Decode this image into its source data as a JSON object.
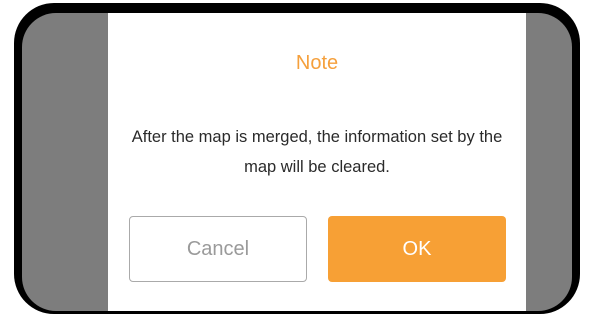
{
  "dialog": {
    "title": "Note",
    "message": "After the map is merged, the information set by the map will be cleared.",
    "cancel_label": "Cancel",
    "ok_label": "OK"
  },
  "colors": {
    "accent": "#f7a035",
    "title": "#f5a03c",
    "overlay": "#7d7d7d",
    "frame": "#000000"
  }
}
